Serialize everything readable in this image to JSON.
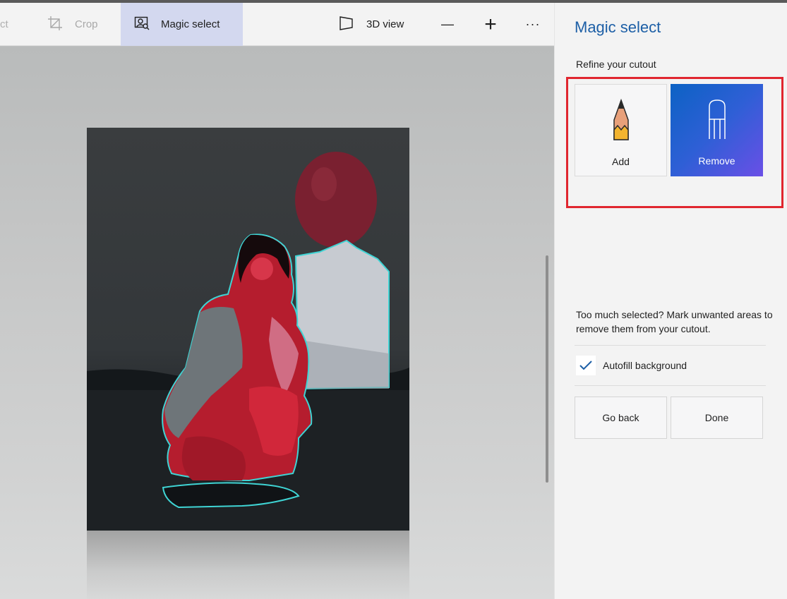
{
  "toolbar": {
    "select_label": "Select",
    "crop_label": "Crop",
    "magic_select_label": "Magic select",
    "view3d_label": "3D view",
    "zoom_out_glyph": "—",
    "zoom_in_glyph": "+",
    "more_glyph": "···"
  },
  "panel": {
    "title": "Magic select",
    "subtitle": "Refine your cutout",
    "add_label": "Add",
    "remove_label": "Remove",
    "help_text": "Too much selected? Mark unwanted areas to remove them from your cutout.",
    "autofill_label": "Autofill background",
    "autofill_checked": true,
    "go_back_label": "Go back",
    "done_label": "Done"
  },
  "colors": {
    "accent": "#1d5fa6",
    "highlight_box": "#e0262f",
    "remove_gradient_start": "#0c62c4",
    "remove_gradient_end": "#6a4fe6",
    "selection_outline": "#3fd4d4"
  },
  "icons": {
    "crop": "crop-icon",
    "magic_select": "magic-select-icon",
    "view3d": "3d-view-icon",
    "add": "pencil-icon",
    "remove": "eraser-icon",
    "check": "checkmark-icon"
  }
}
